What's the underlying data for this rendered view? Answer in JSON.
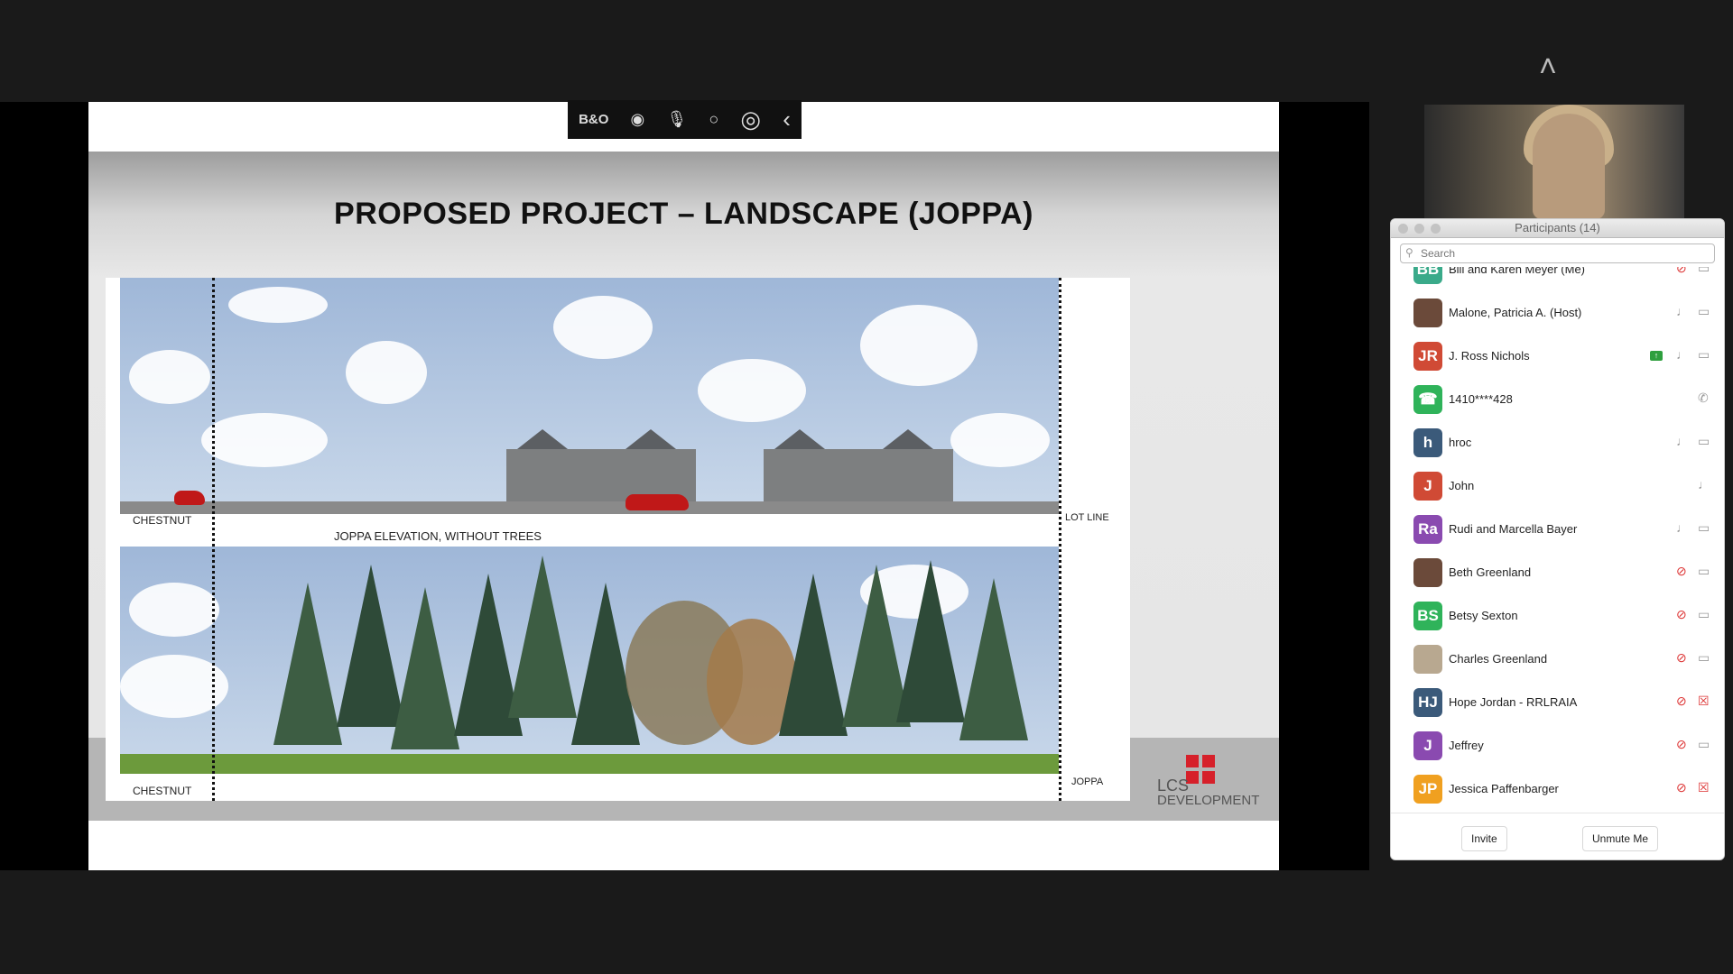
{
  "slide": {
    "title": "PROPOSED PROJECT – LANDSCAPE (JOPPA)",
    "labels": {
      "chestnut_top": "CHESTNUT",
      "chestnut_bottom": "CHESTNUT",
      "lot_line": "LOT LINE",
      "joppa": "JOPPA",
      "elevation_caption": "JOPPA ELEVATION, WITHOUT TREES"
    },
    "logo": {
      "line1": "LCS",
      "line2": "DEVELOPMENT",
      "brand_color": "#d6202a"
    }
  },
  "toolbar": {
    "icons": [
      "bo-logo-icon",
      "record-icon",
      "mic-icon",
      "circle-icon",
      "audio-icon",
      "collapse-icon"
    ],
    "bo": "B&O",
    "record": "◉",
    "mic": "🎙",
    "circle": "○",
    "audio": "◎",
    "collapse": "‹"
  },
  "nav": {
    "up": "˄",
    "down": "˅"
  },
  "participants": {
    "title": "Participants (14)",
    "search_placeholder": "Search",
    "rows": [
      {
        "initials": "BB",
        "name": "Bill and Karen Meyer (Me)",
        "color": "#3aaa8a",
        "mic": "muted",
        "video": "on"
      },
      {
        "initials": "",
        "name": "Malone, Patricia A. (Host)",
        "color": "#6b4a3a",
        "mic": "on",
        "video": "on"
      },
      {
        "initials": "JR",
        "name": "J. Ross Nichols",
        "color": "#d04a35",
        "mic": "on",
        "video": "on",
        "sharing": true
      },
      {
        "initials": "☎",
        "name": "1410****428",
        "color": "#2fb35a",
        "mic": "phone",
        "video": "none"
      },
      {
        "initials": "h",
        "name": "hroc",
        "color": "#3b5a7a",
        "mic": "on",
        "video": "on"
      },
      {
        "initials": "J",
        "name": "John",
        "color": "#d04a35",
        "mic": "on",
        "video": "none"
      },
      {
        "initials": "Ra",
        "name": "Rudi and Marcella Bayer",
        "color": "#8a4ab0",
        "mic": "on",
        "video": "on"
      },
      {
        "initials": "",
        "name": "Beth Greenland",
        "color": "#6b4a3a",
        "mic": "muted",
        "video": "on"
      },
      {
        "initials": "BS",
        "name": "Betsy Sexton",
        "color": "#2fb35a",
        "mic": "muted",
        "video": "on"
      },
      {
        "initials": "",
        "name": "Charles Greenland",
        "color": "#b8a890",
        "mic": "muted",
        "video": "on"
      },
      {
        "initials": "HJ",
        "name": "Hope Jordan - RRLRAIA",
        "color": "#3b5a7a",
        "mic": "muted",
        "video": "off"
      },
      {
        "initials": "J",
        "name": "Jeffrey",
        "color": "#8a4ab0",
        "mic": "muted",
        "video": "on"
      },
      {
        "initials": "JP",
        "name": "Jessica Paffenbarger",
        "color": "#f0a020",
        "mic": "muted",
        "video": "off"
      }
    ],
    "invite_label": "Invite",
    "unmute_label": "Unmute Me"
  }
}
